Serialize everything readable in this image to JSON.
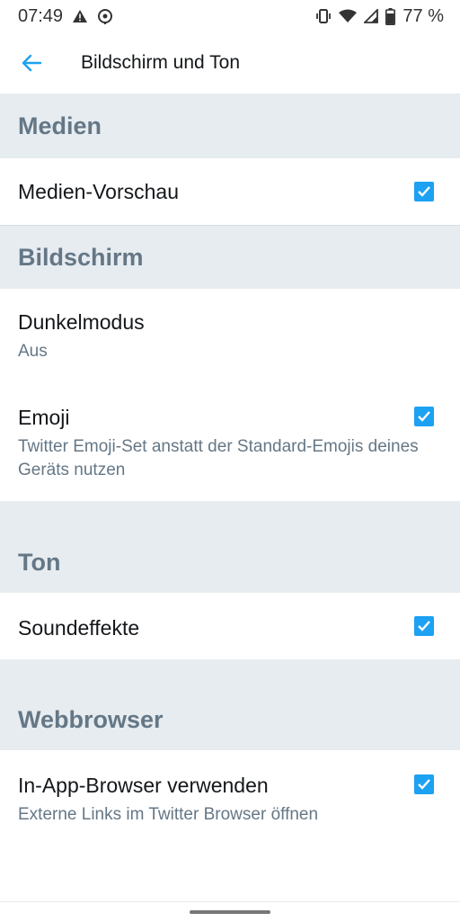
{
  "status_bar": {
    "time": "07:49",
    "battery": "77 %",
    "icons": [
      "warning-icon",
      "location-icon",
      "vibrate-icon",
      "wifi-icon",
      "signal-icon",
      "battery-icon"
    ]
  },
  "app_bar": {
    "title": "Bildschirm und Ton",
    "back_icon": "back-arrow-icon"
  },
  "sections": {
    "medien": {
      "header": "Medien",
      "items": [
        {
          "title": "Medien-Vorschau",
          "checked": true
        }
      ]
    },
    "bildschirm": {
      "header": "Bildschirm",
      "items": [
        {
          "title": "Dunkelmodus",
          "subtitle": "Aus"
        },
        {
          "title": "Emoji",
          "subtitle": "Twitter Emoji-Set anstatt der Standard-Emojis deines Geräts nutzen",
          "checked": true
        }
      ]
    },
    "ton": {
      "header": "Ton",
      "items": [
        {
          "title": "Soundeffekte",
          "checked": true
        }
      ]
    },
    "webbrowser": {
      "header": "Webbrowser",
      "items": [
        {
          "title": "In-App-Browser verwenden",
          "subtitle": "Externe Links im Twitter Browser öffnen",
          "checked": true
        }
      ]
    }
  },
  "colors": {
    "accent": "#1da1f2",
    "section_bg": "#e6ecf0",
    "section_text": "#657786",
    "primary_text": "#14171a"
  }
}
